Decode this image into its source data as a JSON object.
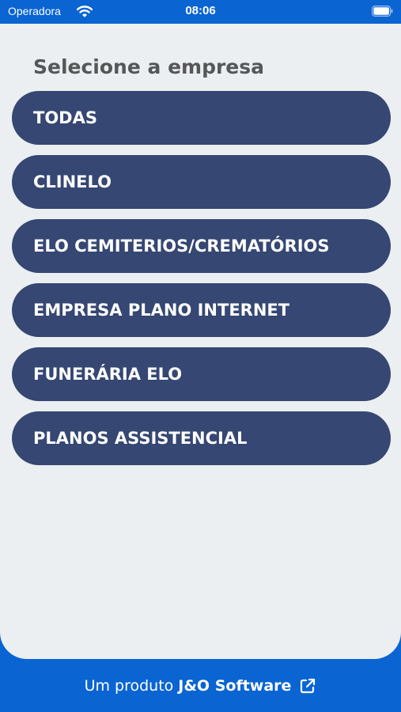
{
  "status_bar": {
    "carrier": "Operadora",
    "time": "08:06"
  },
  "header": {
    "title": "Selecione a empresa"
  },
  "companies": [
    {
      "label": "TODAS"
    },
    {
      "label": "CLINELO"
    },
    {
      "label": "ELO CEMITERIOS/CREMATÓRIOS"
    },
    {
      "label": "EMPRESA PLANO INTERNET"
    },
    {
      "label": "FUNERÁRIA ELO"
    },
    {
      "label": "PLANOS ASSISTENCIAL"
    }
  ],
  "footer": {
    "prefix": "Um produto",
    "brand": "J&O Software"
  },
  "colors": {
    "brand_blue": "#0a64d2",
    "button_navy": "#354772",
    "background": "#ebeff1",
    "title_gray": "#555759"
  },
  "icons": {
    "status_wifi": "wifi-icon",
    "status_battery": "battery-icon",
    "footer_link": "external-link-icon"
  }
}
